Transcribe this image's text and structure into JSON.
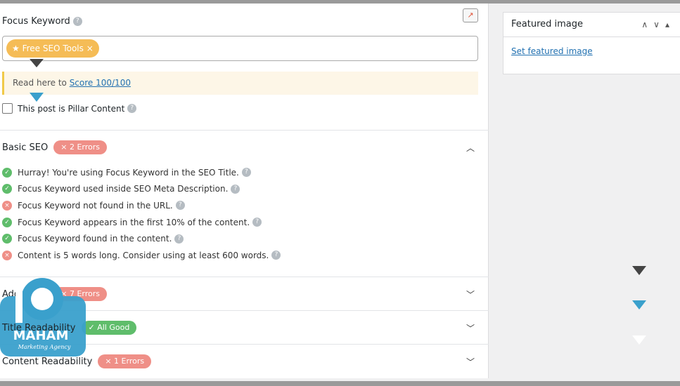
{
  "focus_keyword": {
    "label": "Focus Keyword",
    "keyword": "Free SEO Tools",
    "remove": "×",
    "trend_icon": "trend-chart-icon"
  },
  "notice": {
    "text": "Read here to ",
    "link": "Score 100/100"
  },
  "pillar": {
    "label": "This post is Pillar Content",
    "checked": false
  },
  "sections": [
    {
      "title": "Basic SEO",
      "badge": "× 2 Errors",
      "status": "error",
      "expanded": true,
      "checks": [
        {
          "text": "Hurray! You're using Focus Keyword in the SEO Title.",
          "pass": true
        },
        {
          "text": "Focus Keyword used inside SEO Meta Description.",
          "pass": true
        },
        {
          "text": "Focus Keyword not found in the URL.",
          "pass": false
        },
        {
          "text": "Focus Keyword appears in the first 10% of the content.",
          "pass": true
        },
        {
          "text": "Focus Keyword found in the content.",
          "pass": true
        },
        {
          "text": "Content is 5 words long. Consider using at least 600 words.",
          "pass": false
        }
      ]
    },
    {
      "title": "Additional",
      "badge": "× 7 Errors",
      "status": "error",
      "expanded": false
    },
    {
      "title": "Title Readability",
      "badge": "✓ All Good",
      "status": "good",
      "expanded": false
    },
    {
      "title": "Content Readability",
      "badge": "× 1 Errors",
      "status": "error",
      "expanded": false
    }
  ],
  "sidebar": {
    "title": "Featured image",
    "link": "Set featured image"
  },
  "watermark": {
    "name": "MAHAM",
    "tagline": "Marketing Agency",
    "color": "#3aa0cc"
  },
  "colors": {
    "error": "#ef8f87",
    "good": "#5fbd6b",
    "keyword": "#f5b544",
    "link": "#2271b1"
  }
}
